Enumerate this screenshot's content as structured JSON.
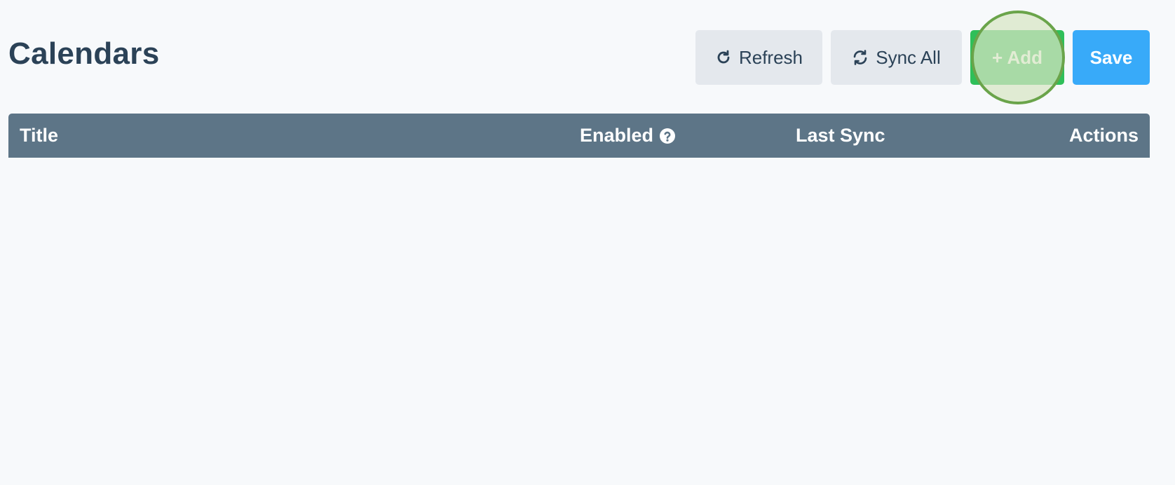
{
  "page": {
    "title": "Calendars"
  },
  "toolbar": {
    "refresh": {
      "label": "Refresh",
      "icon": "refresh-icon"
    },
    "sync_all": {
      "label": "Sync All",
      "icon": "sync-icon"
    },
    "add": {
      "label": "+ Add"
    },
    "save": {
      "label": "Save"
    }
  },
  "table": {
    "columns": [
      {
        "key": "title",
        "label": "Title"
      },
      {
        "key": "enabled",
        "label": "Enabled",
        "icon": "help-circle-icon"
      },
      {
        "key": "last_sync",
        "label": "Last Sync"
      },
      {
        "key": "actions",
        "label": "Actions"
      }
    ],
    "rows": []
  },
  "colors": {
    "background": "#f7f9fb",
    "title_text": "#2b4257",
    "secondary_button": "#e4e8ed",
    "add_button": "#2fbf59",
    "save_button": "#38aaf9",
    "table_header": "#5d7587",
    "click_marker_border": "#6aa44a"
  }
}
